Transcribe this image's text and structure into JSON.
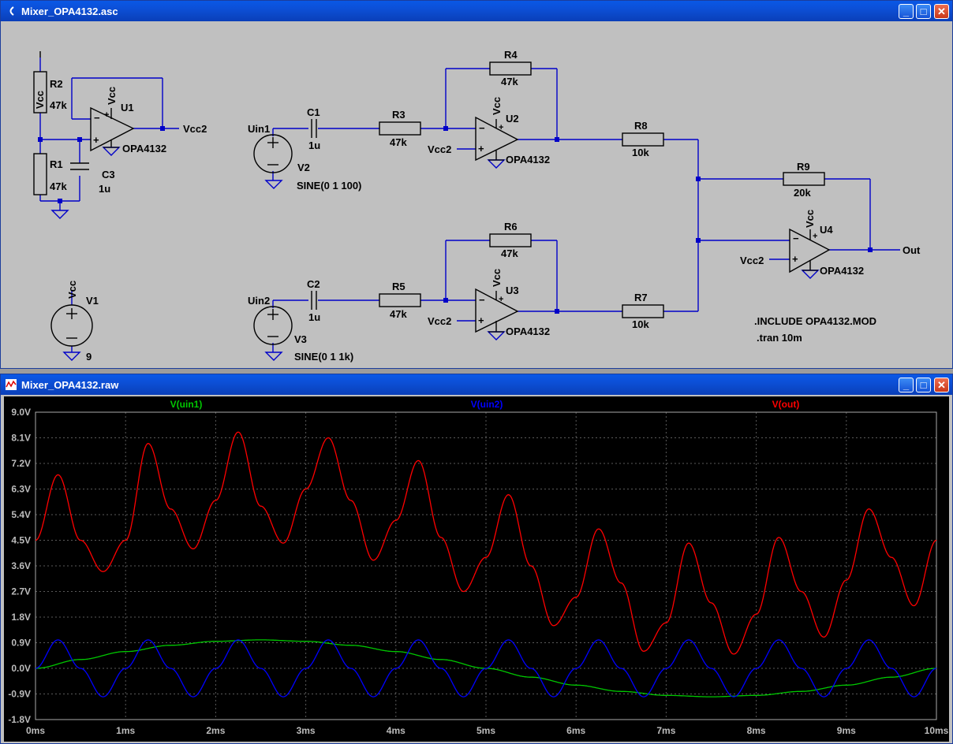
{
  "schematic_window": {
    "title": "Mixer_OPA4132.asc",
    "icon": "ltspice-schematic-icon",
    "labels": {
      "vcc_top": "Vcc",
      "r2": "R2",
      "r2_val": "47k",
      "r1": "R1",
      "r1_val": "47k",
      "c3": "C3",
      "c3_val": "1u",
      "u1": "U1",
      "u1_vcc": "Vcc",
      "u1_model": "OPA4132",
      "vcc2_out": "Vcc2",
      "v1": "V1",
      "v1_vcc": "Vcc",
      "v1_val": "9",
      "uin1": "Uin1",
      "c1": "C1",
      "c1_val": "1u",
      "r3": "R3",
      "r3_val": "47k",
      "v2": "V2",
      "v2_val": "SINE(0 1 100)",
      "r4": "R4",
      "r4_val": "47k",
      "u2": "U2",
      "u2_vcc": "Vcc",
      "u2_vcc2": "Vcc2",
      "u2_model": "OPA4132",
      "r8": "R8",
      "r8_val": "10k",
      "r9": "R9",
      "r9_val": "20k",
      "u4": "U4",
      "u4_vcc": "Vcc",
      "u4_vcc2": "Vcc2",
      "u4_model": "OPA4132",
      "out": "Out",
      "r6": "R6",
      "r6_val": "47k",
      "uin2": "Uin2",
      "c2": "C2",
      "c2_val": "1u",
      "r5": "R5",
      "r5_val": "47k",
      "v3": "V3",
      "v3_val": "SINE(0 1 1k)",
      "u3": "U3",
      "u3_vcc": "Vcc",
      "u3_vcc2": "Vcc2",
      "u3_model": "OPA4132",
      "r7": "R7",
      "r7_val": "10k",
      "directive1": ".INCLUDE OPA4132.MOD",
      "directive2": ".tran 10m"
    }
  },
  "plot_window": {
    "title": "Mixer_OPA4132.raw",
    "icon": "waveform-icon"
  },
  "window_buttons": {
    "minimize": "_",
    "maximize": "□",
    "close": "✕"
  },
  "colors": {
    "titlebar": "#0c4fd6",
    "plot_bg": "#000000",
    "grid": "#5a5a5a",
    "green": "#00c800",
    "blue": "#0000ff",
    "red": "#ff0000",
    "wire": "#0000c8"
  },
  "chart_data": {
    "type": "line",
    "title": "",
    "xlabel": "",
    "ylabel": "",
    "x_ticks": [
      "0ms",
      "1ms",
      "2ms",
      "3ms",
      "4ms",
      "5ms",
      "6ms",
      "7ms",
      "8ms",
      "9ms",
      "10ms"
    ],
    "y_ticks": [
      "9.0V",
      "8.1V",
      "7.2V",
      "6.3V",
      "5.4V",
      "4.5V",
      "3.6V",
      "2.7V",
      "1.8V",
      "0.9V",
      "0.0V",
      "-0.9V",
      "-1.8V"
    ],
    "xlim": [
      0,
      10
    ],
    "ylim": [
      -1.8,
      9.0
    ],
    "x_unit": "ms",
    "grid": true,
    "legend_position": "top",
    "series": [
      {
        "name": "V(uin1)",
        "color": "#00c800",
        "x": [
          0,
          0.5,
          1,
          1.5,
          2,
          2.5,
          3,
          3.5,
          4,
          4.5,
          5,
          5.5,
          6,
          6.5,
          7,
          7.5,
          8,
          8.5,
          9,
          9.5,
          10
        ],
        "y": [
          0,
          0.31,
          0.59,
          0.81,
          0.95,
          1.0,
          0.95,
          0.81,
          0.59,
          0.31,
          0,
          -0.31,
          -0.59,
          -0.81,
          -0.95,
          -1.0,
          -0.95,
          -0.81,
          -0.59,
          -0.31,
          0
        ]
      },
      {
        "name": "V(uin2)",
        "color": "#0000ff",
        "x": [
          0,
          0.25,
          0.5,
          0.75,
          1,
          1.25,
          1.5,
          1.75,
          2,
          2.25,
          2.5,
          2.75,
          3,
          3.25,
          3.5,
          3.75,
          4,
          4.25,
          4.5,
          4.75,
          5,
          5.25,
          5.5,
          5.75,
          6,
          6.25,
          6.5,
          6.75,
          7,
          7.25,
          7.5,
          7.75,
          8,
          8.25,
          8.5,
          8.75,
          9,
          9.25,
          9.5,
          9.75,
          10
        ],
        "y": [
          0,
          1,
          0,
          -1,
          0,
          1,
          0,
          -1,
          0,
          1,
          0,
          -1,
          0,
          1,
          0,
          -1,
          0,
          1,
          0,
          -1,
          0,
          1,
          0,
          -1,
          0,
          1,
          0,
          -1,
          0,
          1,
          0,
          -1,
          0,
          1,
          0,
          -1,
          0,
          1,
          0,
          -1,
          0
        ]
      },
      {
        "name": "V(out)",
        "color": "#ff0000",
        "x": [
          0,
          0.25,
          0.5,
          0.75,
          1,
          1.25,
          1.5,
          1.75,
          2,
          2.25,
          2.5,
          2.75,
          3,
          3.25,
          3.5,
          3.75,
          4,
          4.25,
          4.5,
          4.75,
          5,
          5.25,
          5.5,
          5.75,
          6,
          6.25,
          6.5,
          6.75,
          7,
          7.25,
          7.5,
          7.75,
          8,
          8.25,
          8.5,
          8.75,
          9,
          9.25,
          9.5,
          9.75,
          10
        ],
        "y": [
          4.5,
          6.8,
          4.5,
          3.4,
          4.5,
          7.9,
          5.6,
          4.2,
          5.9,
          8.3,
          5.7,
          4.4,
          6.3,
          8.1,
          5.9,
          3.8,
          5.2,
          7.3,
          4.6,
          2.7,
          3.9,
          6.1,
          3.6,
          1.5,
          2.5,
          4.9,
          3.0,
          0.6,
          1.6,
          4.4,
          2.3,
          0.5,
          1.9,
          4.6,
          2.7,
          1.1,
          3.1,
          5.6,
          3.9,
          2.2,
          4.5
        ]
      }
    ]
  }
}
